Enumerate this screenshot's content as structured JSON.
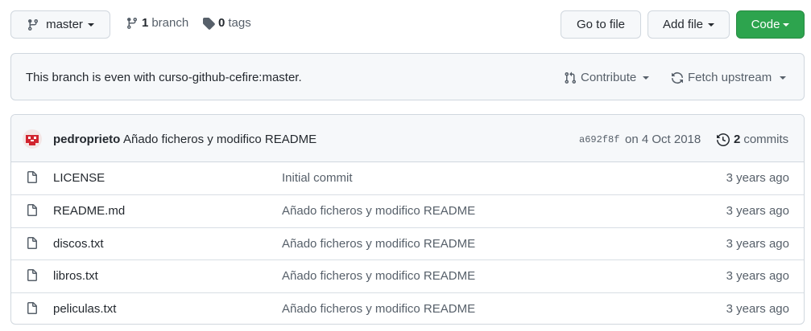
{
  "toolbar": {
    "branch_label": "master",
    "branches_count": "1",
    "branches_label": "branch",
    "tags_count": "0",
    "tags_label": "tags",
    "goto_label": "Go to file",
    "addfile_label": "Add file",
    "code_label": "Code"
  },
  "compare_bar": {
    "status_text": "This branch is even with curso-github-cefire:master.",
    "contribute_label": "Contribute",
    "fetch_label": "Fetch upstream"
  },
  "commit": {
    "author": "pedroprieto",
    "message": "Añado ficheros y modifico README",
    "sha": "a692f8f",
    "date": "on 4 Oct 2018",
    "commits_count": "2",
    "commits_label": "commits"
  },
  "files": [
    {
      "name": "LICENSE",
      "message": "Initial commit",
      "age": "3 years ago"
    },
    {
      "name": "README.md",
      "message": "Añado ficheros y modifico README",
      "age": "3 years ago"
    },
    {
      "name": "discos.txt",
      "message": "Añado ficheros y modifico README",
      "age": "3 years ago"
    },
    {
      "name": "libros.txt",
      "message": "Añado ficheros y modifico README",
      "age": "3 years ago"
    },
    {
      "name": "peliculas.txt",
      "message": "Añado ficheros y modifico README",
      "age": "3 years ago"
    }
  ],
  "icons": {
    "branch": "git-branch-icon",
    "tag": "tag-icon",
    "pull_request": "git-pull-request-icon",
    "sync": "sync-icon",
    "history": "history-icon",
    "file": "file-icon"
  },
  "colors": {
    "code_button": "#2da44e",
    "avatar": "#d1242f"
  }
}
